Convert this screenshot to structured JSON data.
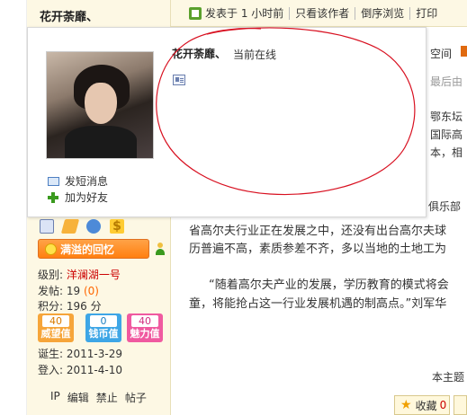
{
  "author": {
    "name": "花开荼靡、"
  },
  "post_bar": {
    "posted_time": "发表于 1 小时前",
    "only_author": "只看该作者",
    "reverse_view": "倒序浏览",
    "print": "打印"
  },
  "popup": {
    "name": "花开荼靡、",
    "status": "当前在线",
    "send_message": "发短消息",
    "add_friend": "加为好友"
  },
  "right_partial": {
    "space": "空间",
    "last_reply": "最后由",
    "line1": "鄂东坛",
    "line2": "国际高",
    "line3": "本，相",
    "line4": "俱乐部"
  },
  "article": {
    "line1": "省高尔夫行业正在发展之中，还没有出台高尔夫球",
    "line2": "历普遍不高，素质参差不齐，多以当地的土地工为",
    "line3": "“随着高尔夫产业的发展，学历教育的模式将会",
    "line4": "童，将能抢占这一行业发展机遇的制高点。”刘军华",
    "topic_partial": "本主题"
  },
  "user_stats": {
    "glory_label": "满溢的回忆",
    "level_label": "级别:",
    "level_value": "洋澜湖一号",
    "posts_label": "发帖:",
    "posts_value": "19",
    "posts_extra": "(0)",
    "points_label": "积分:",
    "points_value": "196 分",
    "prestige_value": "40",
    "prestige_label": "威望值",
    "coin_value": "0",
    "coin_label": "钱币值",
    "charm_value": "40",
    "charm_label": "魅力值",
    "birth_label": "诞生:",
    "birth_value": "2011-3-29",
    "login_label": "登入:",
    "login_value": "2011-4-10"
  },
  "footer": {
    "ip": "IP",
    "edit": "编辑",
    "ban": "禁止",
    "posts": "帖子"
  },
  "collect": {
    "label": "收藏",
    "count": "0"
  },
  "colors": {
    "orange_button": "#ff7f10",
    "annotation_red": "#d81020",
    "level_red": "#cc0000"
  }
}
